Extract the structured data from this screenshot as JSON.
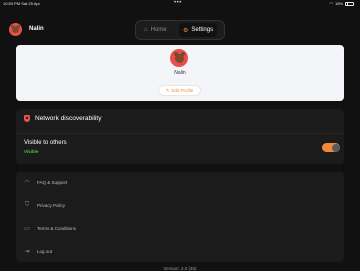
{
  "status_bar": {
    "time": "10:59 PM  Sat 25 Apr",
    "battery": "18%"
  },
  "header": {
    "user_name": "Nalin"
  },
  "tabs": [
    {
      "label": "Home",
      "icon": "home-icon"
    },
    {
      "label": "Settings",
      "icon": "gear-icon"
    }
  ],
  "profile": {
    "name": "Nalin",
    "edit_label": "Edit Profile"
  },
  "network": {
    "title": "Network discoverability",
    "visible_label": "Visible to others",
    "visible_status": "Visible",
    "toggle_on": true
  },
  "links": [
    {
      "label": "FAQ & Support",
      "icon": "headphones-icon"
    },
    {
      "label": "Privacy Policy",
      "icon": "shield-icon"
    },
    {
      "label": "Terms & Conditions",
      "icon": "document-icon"
    },
    {
      "label": "Log out",
      "icon": "logout-icon"
    }
  ],
  "footer": {
    "version": "Version: 2.0 (45)"
  },
  "colors": {
    "accent": "#f08a3a",
    "visible": "#39c25a",
    "avatar": "#e84f4a"
  }
}
